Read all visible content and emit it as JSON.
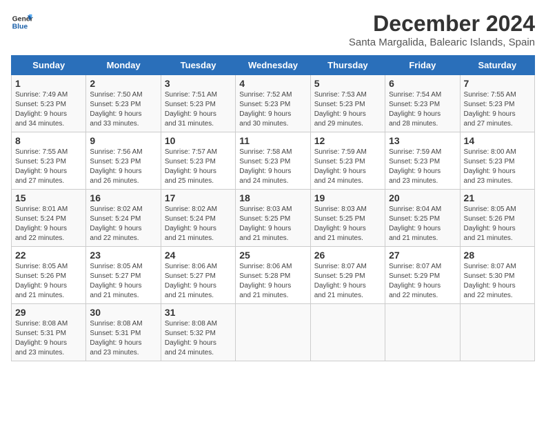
{
  "logo": {
    "line1": "General",
    "line2": "Blue"
  },
  "title": "December 2024",
  "subtitle": "Santa Margalida, Balearic Islands, Spain",
  "days_of_week": [
    "Sunday",
    "Monday",
    "Tuesday",
    "Wednesday",
    "Thursday",
    "Friday",
    "Saturday"
  ],
  "weeks": [
    [
      {
        "day": "1",
        "info": "Sunrise: 7:49 AM\nSunset: 5:23 PM\nDaylight: 9 hours\nand 34 minutes."
      },
      {
        "day": "2",
        "info": "Sunrise: 7:50 AM\nSunset: 5:23 PM\nDaylight: 9 hours\nand 33 minutes."
      },
      {
        "day": "3",
        "info": "Sunrise: 7:51 AM\nSunset: 5:23 PM\nDaylight: 9 hours\nand 31 minutes."
      },
      {
        "day": "4",
        "info": "Sunrise: 7:52 AM\nSunset: 5:23 PM\nDaylight: 9 hours\nand 30 minutes."
      },
      {
        "day": "5",
        "info": "Sunrise: 7:53 AM\nSunset: 5:23 PM\nDaylight: 9 hours\nand 29 minutes."
      },
      {
        "day": "6",
        "info": "Sunrise: 7:54 AM\nSunset: 5:23 PM\nDaylight: 9 hours\nand 28 minutes."
      },
      {
        "day": "7",
        "info": "Sunrise: 7:55 AM\nSunset: 5:23 PM\nDaylight: 9 hours\nand 27 minutes."
      }
    ],
    [
      {
        "day": "8",
        "info": "Sunrise: 7:55 AM\nSunset: 5:23 PM\nDaylight: 9 hours\nand 27 minutes."
      },
      {
        "day": "9",
        "info": "Sunrise: 7:56 AM\nSunset: 5:23 PM\nDaylight: 9 hours\nand 26 minutes."
      },
      {
        "day": "10",
        "info": "Sunrise: 7:57 AM\nSunset: 5:23 PM\nDaylight: 9 hours\nand 25 minutes."
      },
      {
        "day": "11",
        "info": "Sunrise: 7:58 AM\nSunset: 5:23 PM\nDaylight: 9 hours\nand 24 minutes."
      },
      {
        "day": "12",
        "info": "Sunrise: 7:59 AM\nSunset: 5:23 PM\nDaylight: 9 hours\nand 24 minutes."
      },
      {
        "day": "13",
        "info": "Sunrise: 7:59 AM\nSunset: 5:23 PM\nDaylight: 9 hours\nand 23 minutes."
      },
      {
        "day": "14",
        "info": "Sunrise: 8:00 AM\nSunset: 5:23 PM\nDaylight: 9 hours\nand 23 minutes."
      }
    ],
    [
      {
        "day": "15",
        "info": "Sunrise: 8:01 AM\nSunset: 5:24 PM\nDaylight: 9 hours\nand 22 minutes."
      },
      {
        "day": "16",
        "info": "Sunrise: 8:02 AM\nSunset: 5:24 PM\nDaylight: 9 hours\nand 22 minutes."
      },
      {
        "day": "17",
        "info": "Sunrise: 8:02 AM\nSunset: 5:24 PM\nDaylight: 9 hours\nand 21 minutes."
      },
      {
        "day": "18",
        "info": "Sunrise: 8:03 AM\nSunset: 5:25 PM\nDaylight: 9 hours\nand 21 minutes."
      },
      {
        "day": "19",
        "info": "Sunrise: 8:03 AM\nSunset: 5:25 PM\nDaylight: 9 hours\nand 21 minutes."
      },
      {
        "day": "20",
        "info": "Sunrise: 8:04 AM\nSunset: 5:25 PM\nDaylight: 9 hours\nand 21 minutes."
      },
      {
        "day": "21",
        "info": "Sunrise: 8:05 AM\nSunset: 5:26 PM\nDaylight: 9 hours\nand 21 minutes."
      }
    ],
    [
      {
        "day": "22",
        "info": "Sunrise: 8:05 AM\nSunset: 5:26 PM\nDaylight: 9 hours\nand 21 minutes."
      },
      {
        "day": "23",
        "info": "Sunrise: 8:05 AM\nSunset: 5:27 PM\nDaylight: 9 hours\nand 21 minutes."
      },
      {
        "day": "24",
        "info": "Sunrise: 8:06 AM\nSunset: 5:27 PM\nDaylight: 9 hours\nand 21 minutes."
      },
      {
        "day": "25",
        "info": "Sunrise: 8:06 AM\nSunset: 5:28 PM\nDaylight: 9 hours\nand 21 minutes."
      },
      {
        "day": "26",
        "info": "Sunrise: 8:07 AM\nSunset: 5:29 PM\nDaylight: 9 hours\nand 21 minutes."
      },
      {
        "day": "27",
        "info": "Sunrise: 8:07 AM\nSunset: 5:29 PM\nDaylight: 9 hours\nand 22 minutes."
      },
      {
        "day": "28",
        "info": "Sunrise: 8:07 AM\nSunset: 5:30 PM\nDaylight: 9 hours\nand 22 minutes."
      }
    ],
    [
      {
        "day": "29",
        "info": "Sunrise: 8:08 AM\nSunset: 5:31 PM\nDaylight: 9 hours\nand 23 minutes."
      },
      {
        "day": "30",
        "info": "Sunrise: 8:08 AM\nSunset: 5:31 PM\nDaylight: 9 hours\nand 23 minutes."
      },
      {
        "day": "31",
        "info": "Sunrise: 8:08 AM\nSunset: 5:32 PM\nDaylight: 9 hours\nand 24 minutes."
      },
      null,
      null,
      null,
      null
    ]
  ]
}
